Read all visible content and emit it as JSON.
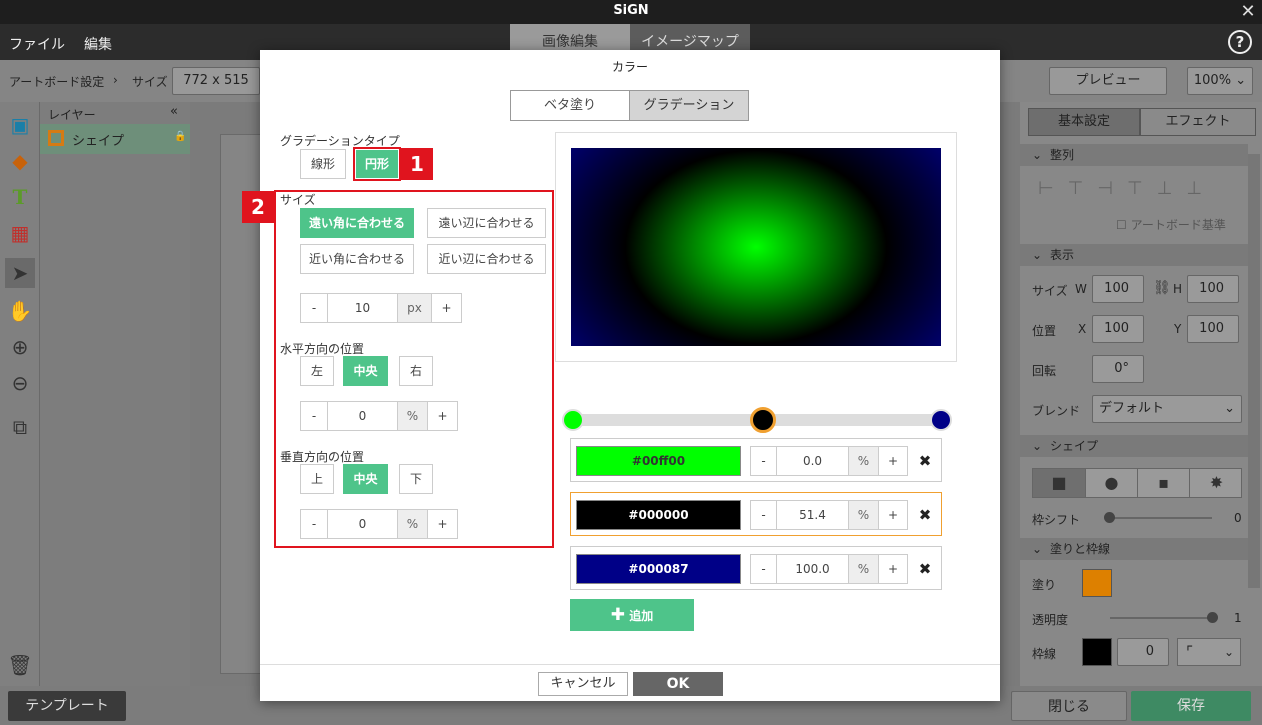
{
  "app": {
    "title": "SiGN"
  },
  "menu": {
    "file": "ファイル",
    "edit": "編集"
  },
  "top_tabs": [
    "画像編集",
    "イメージマップ"
  ],
  "help_label": "?",
  "toolbar": {
    "artboard_setting": "アートボード設定",
    "size_label": "サイズ",
    "size_value": "772 x 515",
    "preview": "プレビュー",
    "zoom": "100%"
  },
  "layers": {
    "header": "レイヤー",
    "item": "シェイプ"
  },
  "right_panel": {
    "tabs": [
      "基本設定",
      "エフェクト"
    ],
    "sections": {
      "align": "整列",
      "display": "表示",
      "shape": "シェイプ",
      "fill_stroke": "塗りと枠線"
    },
    "artboard_ref": "アートボード基準",
    "size": "サイズ",
    "w": "W",
    "h": "H",
    "w_val": "100",
    "h_val": "100",
    "position": "位置",
    "x": "X",
    "y": "Y",
    "x_val": "100",
    "y_val": "100",
    "rotation": "回転",
    "rotation_val": "0°",
    "blend": "ブレンド",
    "blend_val": "デフォルト",
    "frame_shift": "枠シフト",
    "frame_shift_val": "0",
    "fill": "塗り",
    "opacity": "透明度",
    "opacity_val": "1",
    "stroke": "枠線",
    "stroke_val": "0",
    "fill_color": "#dd8000"
  },
  "bottom": {
    "template": "テンプレート",
    "close": "閉じる",
    "save": "保存"
  },
  "modal": {
    "title": "カラー",
    "fill_tabs": [
      "ベタ塗り",
      "グラデーション"
    ],
    "gradient_type_label": "グラデーションタイプ",
    "type_linear": "線形",
    "type_radial": "円形",
    "size_label": "サイズ",
    "size_opts": [
      "遠い角に合わせる",
      "遠い辺に合わせる",
      "近い角に合わせる",
      "近い辺に合わせる"
    ],
    "size_minus": "-",
    "size_value": "10",
    "size_unit": "px",
    "size_plus": "+",
    "h_pos_label": "水平方向の位置",
    "h_opts": [
      "左",
      "中央",
      "右"
    ],
    "h_value": "0",
    "h_unit": "%",
    "v_pos_label": "垂直方向の位置",
    "v_opts": [
      "上",
      "中央",
      "下"
    ],
    "v_value": "0",
    "v_unit": "%",
    "stops": [
      {
        "color": "#00ff00",
        "label": "#00ff00",
        "pos": "0.0",
        "unit": "%"
      },
      {
        "color": "#000000",
        "label": "#000000",
        "pos": "51.4",
        "unit": "%"
      },
      {
        "color": "#000087",
        "label": "#000087",
        "pos": "100.0",
        "unit": "%"
      }
    ],
    "add": "追加",
    "cancel": "キャンセル",
    "ok": "OK"
  },
  "annotations": [
    "1",
    "2"
  ]
}
